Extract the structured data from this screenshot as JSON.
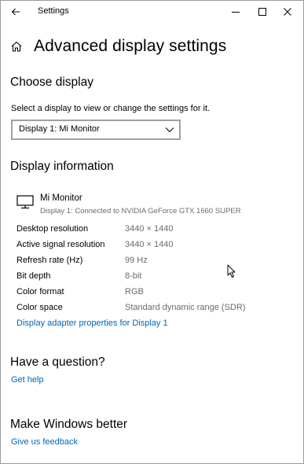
{
  "window": {
    "title": "Settings"
  },
  "header": {
    "title": "Advanced display settings"
  },
  "choose_display": {
    "heading": "Choose display",
    "description": "Select a display to view or change the settings for it.",
    "dropdown_value": "Display 1: Mi Monitor"
  },
  "display_info": {
    "heading": "Display information",
    "monitor_name": "Mi Monitor",
    "monitor_connection": "Display 1: Connected to NVIDIA GeForce GTX 1660 SUPER",
    "rows": [
      {
        "label": "Desktop resolution",
        "value": "3440 × 1440"
      },
      {
        "label": "Active signal resolution",
        "value": "3440 × 1440"
      },
      {
        "label": "Refresh rate (Hz)",
        "value": "99 Hz"
      },
      {
        "label": "Bit depth",
        "value": "8-bit"
      },
      {
        "label": "Color format",
        "value": "RGB"
      },
      {
        "label": "Color space",
        "value": "Standard dynamic range (SDR)"
      }
    ],
    "adapter_link": "Display adapter properties for Display 1"
  },
  "question": {
    "heading": "Have a question?",
    "link": "Get help"
  },
  "feedback": {
    "heading": "Make Windows better",
    "link": "Give us feedback"
  },
  "icons": {
    "back": "back-arrow-icon",
    "minimize": "minimize-icon",
    "maximize": "maximize-icon",
    "close": "close-icon",
    "home": "home-icon",
    "chevron": "chevron-down-icon",
    "monitor": "monitor-icon",
    "cursor": "mouse-pointer-icon"
  },
  "colors": {
    "link": "#0066b4",
    "secondary_text": "#6b6b6b",
    "dropdown_border": "#a0a0a0"
  }
}
